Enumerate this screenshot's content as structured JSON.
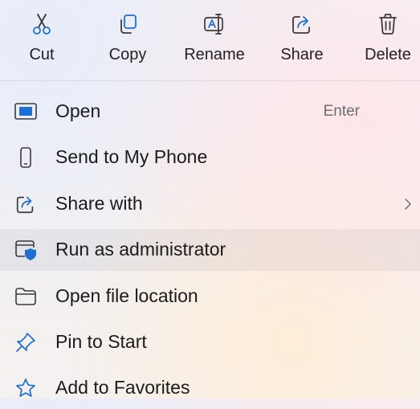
{
  "toolbar": {
    "items": [
      {
        "label": "Cut",
        "icon": "scissors-icon"
      },
      {
        "label": "Copy",
        "icon": "copy-icon"
      },
      {
        "label": "Rename",
        "icon": "rename-icon"
      },
      {
        "label": "Share",
        "icon": "share-icon"
      },
      {
        "label": "Delete",
        "icon": "trash-icon"
      }
    ]
  },
  "menu": {
    "items": [
      {
        "label": "Open",
        "shortcut": "Enter",
        "icon": "open-window-icon"
      },
      {
        "label": "Send to My Phone",
        "icon": "phone-icon"
      },
      {
        "label": "Share with",
        "icon": "share-icon",
        "submenu": true
      },
      {
        "label": "Run as administrator",
        "icon": "shield-window-icon",
        "highlighted": true
      },
      {
        "label": "Open file location",
        "icon": "folder-icon"
      },
      {
        "label": "Pin to Start",
        "icon": "pin-icon"
      },
      {
        "label": "Add to Favorites",
        "icon": "star-icon"
      }
    ]
  },
  "colors": {
    "accent": "#1f6fd1",
    "text": "#1b1b1b",
    "secondary_text": "#6d6d6d"
  }
}
